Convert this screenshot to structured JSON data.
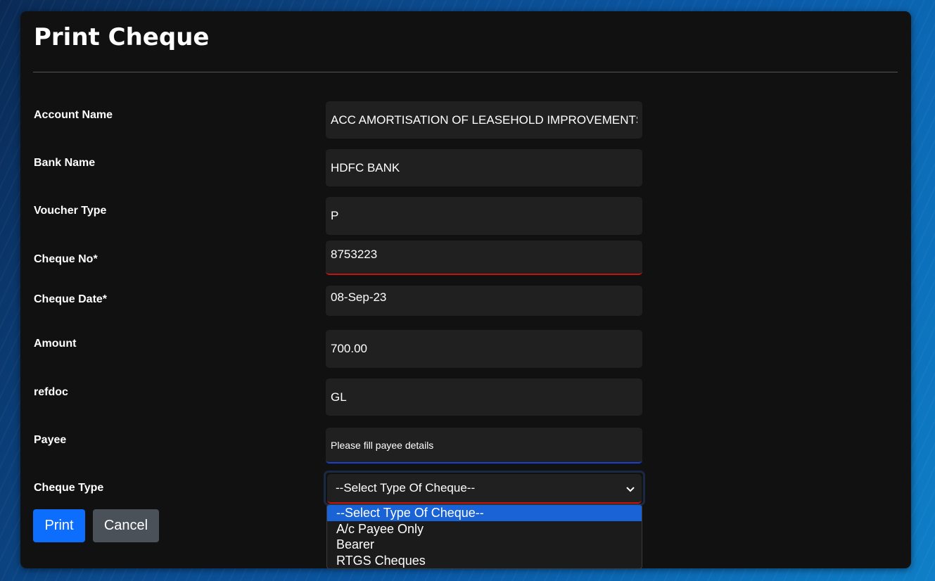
{
  "modal": {
    "title": "Print Cheque"
  },
  "form": {
    "account_name": {
      "label": "Account Name",
      "value": "ACC AMORTISATION OF LEASEHOLD IMPROVEMENTS"
    },
    "bank_name": {
      "label": "Bank Name",
      "value": "HDFC BANK"
    },
    "voucher_type": {
      "label": "Voucher Type",
      "value": "P"
    },
    "cheque_no": {
      "label": "Cheque No*",
      "value": "8753223"
    },
    "cheque_date": {
      "label": "Cheque Date*",
      "value": "08-Sep-23"
    },
    "amount": {
      "label": "Amount",
      "value": "700.00"
    },
    "refdoc": {
      "label": "refdoc",
      "value": "GL"
    },
    "payee": {
      "label": "Payee",
      "placeholder": "Please fill payee details"
    },
    "cheque_type": {
      "label": "Cheque Type",
      "selected": "--Select Type Of Cheque--",
      "options": [
        "--Select Type Of Cheque--",
        "A/c Payee Only",
        "Bearer",
        "RTGS Cheques"
      ]
    }
  },
  "buttons": {
    "print": "Print",
    "cancel": "Cancel"
  },
  "colors": {
    "modal_bg": "#111111",
    "field_bg": "#202020",
    "primary": "#0d6efd",
    "secondary": "#4b5159",
    "invalid_underline": "#c0160e",
    "focus_underline": "#1a3fcf",
    "option_highlight": "#1a63d6"
  }
}
